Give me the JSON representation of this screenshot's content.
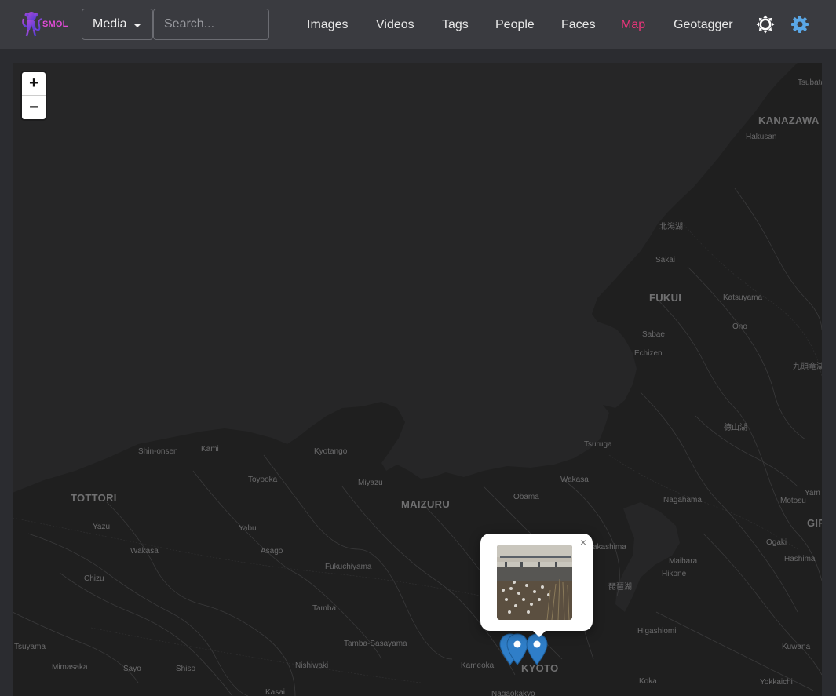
{
  "app": {
    "brand": "SMOL"
  },
  "navbar": {
    "media_label": "Media",
    "search_placeholder": "Search...",
    "links": [
      {
        "label": "Images",
        "active": false
      },
      {
        "label": "Videos",
        "active": false
      },
      {
        "label": "Tags",
        "active": false
      },
      {
        "label": "People",
        "active": false
      },
      {
        "label": "Faces",
        "active": false
      },
      {
        "label": "Map",
        "active": true
      },
      {
        "label": "Geotagger",
        "active": false
      }
    ],
    "icons": [
      "theme-toggle-icon",
      "settings-gear-icon"
    ],
    "active_color": "#e8357a"
  },
  "map": {
    "zoom_in": "+",
    "zoom_out": "−",
    "popup_close": "×",
    "places": {
      "tsubata": "Tsubata",
      "kanazawa": "KANAZAWA",
      "hakusan": "Hakusan",
      "kitagata": "北潟湖",
      "sakai": "Sakai",
      "fukui": "FUKUI",
      "katsuyama": "Katsuyama",
      "ono": "Ono",
      "sabae": "Sabae",
      "echizen": "Echizen",
      "kuzuryu": "九頭竜湖",
      "tokuyama": "徳山湖",
      "shin_onsen": "Shin-onsen",
      "kami": "Kami",
      "kyotango": "Kyotango",
      "tsuruga": "Tsuruga",
      "toyooka": "Toyooka",
      "miyazu": "Miyazu",
      "wakasa": "Wakasa",
      "tottori": "TOTTORI",
      "maizuru": "MAIZURU",
      "obama": "Obama",
      "nagahama": "Nagahama",
      "motosu": "Motosu",
      "yam": "Yam",
      "gif": "GIF",
      "yazu": "Yazu",
      "yabu": "Yabu",
      "wakasa2": "Wakasa",
      "asago": "Asago",
      "fukuchiyama": "Fukuchiyama",
      "takashima": "Takashima",
      "ogaki": "Ogaki",
      "maibara": "Maibara",
      "hashima": "Hashima",
      "chizu": "Chizu",
      "hikone": "Hikone",
      "biwako": "琵琶湖",
      "tamba": "Tamba",
      "higashiomi": "Higashiomi",
      "tsuyama": "Tsuyama",
      "tamba_sasayama": "Tamba-Sasayama",
      "kuwana": "Kuwana",
      "mimasaka": "Mimasaka",
      "sayo": "Sayo",
      "shiso": "Shiso",
      "nishiwaki": "Nishiwaki",
      "kameoka": "Kameoka",
      "kyoto": "KYOTO",
      "koka": "Koka",
      "yokkaichi": "Yokkaichi",
      "kasai": "Kasai",
      "nagaokakyo": "Nagaokakyo"
    },
    "marker_color": "#2f7ec8"
  }
}
